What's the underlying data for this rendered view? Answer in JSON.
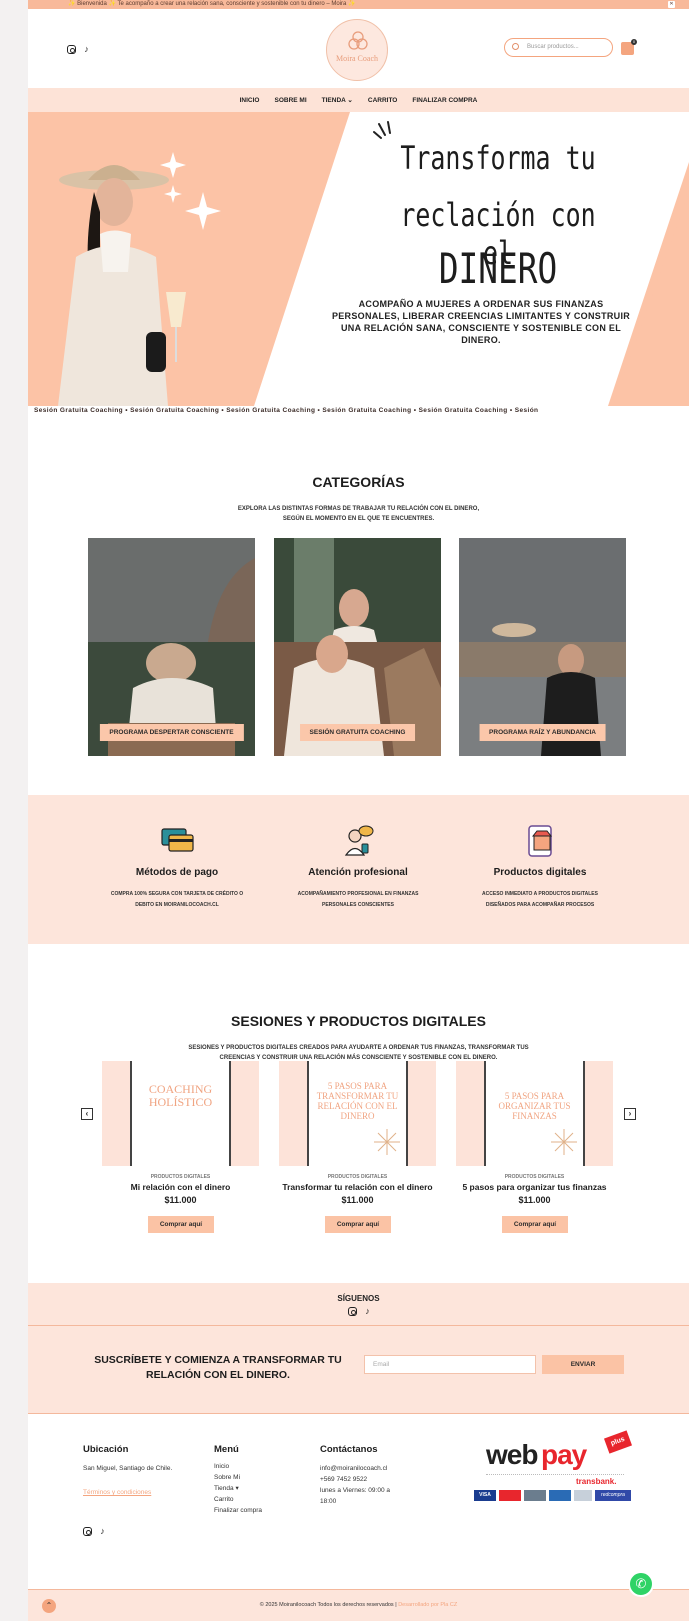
{
  "topbar": {
    "text": "✨ Bienvenida ✨ Te acompaño a crear una relación sana, consciente y sostenible con tu dinero – Moira ✨"
  },
  "header": {
    "logo_text": "Moira Coach",
    "search_placeholder": "Buscar productos...",
    "cart_count": "0"
  },
  "nav": [
    {
      "label": "INICIO"
    },
    {
      "label": "SOBRE MI"
    },
    {
      "label": "TIENDA ⌄"
    },
    {
      "label": "CARRITO"
    },
    {
      "label": "FINALIZAR COMPRA"
    }
  ],
  "hero": {
    "line1": "Transforma tu",
    "line2": "reclación con el",
    "line3": "DINERO",
    "subtitle": "ACOMPAÑO A MUJERES A ORDENAR SUS FINANZAS PERSONALES, LIBERAR CREENCIAS LIMITANTES Y CONSTRUIR UNA RELACIÓN SANA, CONSCIENTE Y SOSTENIBLE CON EL DINERO."
  },
  "marquee": "Sesión Gratuita Coaching • Sesión Gratuita Coaching • Sesión Gratuita Coaching • Sesión Gratuita Coaching • Sesión Gratuita Coaching • Sesión",
  "categories": {
    "title": "CATEGORÍAS",
    "sub1": "EXPLORA LAS DISTINTAS FORMAS DE TRABAJAR TU RELACIÓN CON EL DINERO,",
    "sub2": "SEGÚN EL MOMENTO EN EL QUE TE ENCUENTRES.",
    "items": [
      {
        "label": "PROGRAMA DESPERTAR CONSCIENTE"
      },
      {
        "label": "SESIÓN GRATUITA COACHING"
      },
      {
        "label": "PROGRAMA RAÍZ Y ABUNDANCIA"
      }
    ]
  },
  "features": [
    {
      "title": "Métodos de pago",
      "text1": "COMPRA 100% SEGURA CON TARJETA DE CRÉDITO O",
      "text2": "DEBITO EN MOIRANILOCOACH.CL"
    },
    {
      "title": "Atención profesional",
      "text1": "ACOMPAÑAMIENTO PROFESIONAL EN FINANZAS",
      "text2": "PERSONALES CONSCIENTES"
    },
    {
      "title": "Productos digitales",
      "text1": "ACCESO INMEDIATO A PRODUCTOS DIGITALES",
      "text2": "DISEÑADOS PARA ACOMPAÑAR PROCESOS"
    }
  ],
  "products": {
    "title": "SESIONES Y PRODUCTOS DIGITALES",
    "sub1": "SESIONES Y PRODUCTOS DIGITALES CREADOS PARA AYUDARTE A ORDENAR TUS FINANZAS, TRANSFORMAR TUS",
    "sub2": "CREENCIAS Y CONSTRUIR UNA RELACIÓN MÁS CONSCIENTE Y SOSTENIBLE CON EL DINERO.",
    "items": [
      {
        "cover": "COACHING HOLÍSTICO",
        "category": "PRODUCTOS DIGITALES",
        "name": "Mi relación con el dinero",
        "price": "$11.000",
        "button": "Comprar aquí"
      },
      {
        "cover": "5 PASOS PARA TRANSFORMAR TU RELACIÓN CON EL DINERO",
        "category": "PRODUCTOS DIGITALES",
        "name": "Transformar tu relación con el dinero",
        "price": "$11.000",
        "button": "Comprar aquí"
      },
      {
        "cover": "5 PASOS PARA ORGANIZAR TUS FINANZAS",
        "category": "PRODUCTOS DIGITALES",
        "name": "5 pasos para organizar tus finanzas",
        "price": "$11.000",
        "button": "Comprar aquí"
      }
    ]
  },
  "follow": {
    "title": "SÍGUENOS"
  },
  "subscribe": {
    "line1": "SUSCRÍBETE Y COMIENZA A TRANSFORMAR TU",
    "line2": "RELACIÓN CON EL DINERO.",
    "placeholder": "Email",
    "button": "ENVIAR"
  },
  "footer": {
    "loc_title": "Ubicación",
    "loc_text": "San Miguel, Santiago de Chile.",
    "terms": "Términos y condiciones",
    "menu_title": "Menú",
    "menu": [
      "Inicio",
      "Sobre Mi",
      "Tienda ▾",
      "Carrito",
      "Finalizar compra"
    ],
    "contact_title": "Contáctanos",
    "email": "info@moiranilocoach.cl",
    "phone": "+569 7452 9522",
    "hours1": "lunes a Viernes: 09:00 a",
    "hours2": "18:00",
    "webpay1": "web",
    "webpay2": "pay",
    "webpay_plus": "plus",
    "transbank": "transbank.",
    "cards": [
      "VISA",
      "",
      "",
      "",
      "",
      "redcompra"
    ]
  },
  "copyright": {
    "text": "© 2025 Moiranilocoach Todos los derechos reservados |",
    "credit": "Desarrollado por Pla CZ"
  },
  "colors": {
    "peach": "#fcc3a6",
    "light_peach": "#fde5db",
    "accent": "#f4a57f",
    "whatsapp": "#2fd366"
  }
}
